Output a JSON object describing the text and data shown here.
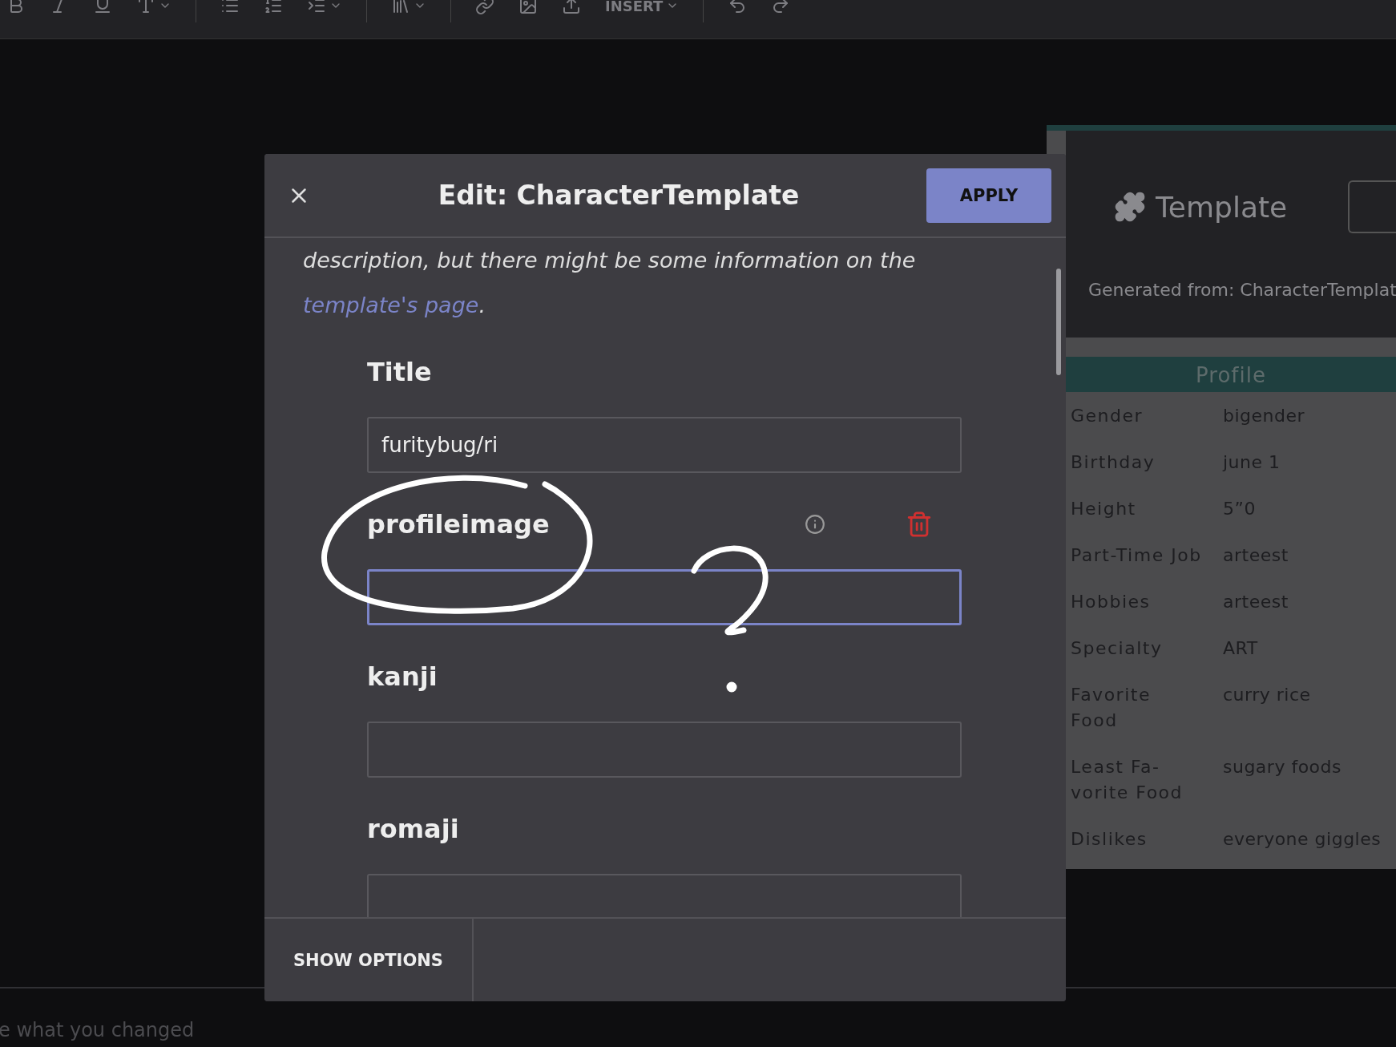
{
  "toolbar": {
    "insert_label": "INSERT"
  },
  "modal": {
    "title": "Edit: CharacterTemplate",
    "apply": "APPLY",
    "description": {
      "text": "description, but there might be some information on the",
      "link": "template's page",
      "end": "."
    },
    "fields": [
      {
        "label": "Title",
        "value": "furitybug/ri",
        "focused": false,
        "removable": false
      },
      {
        "label": "profileimage",
        "focused": true,
        "removable": true
      },
      {
        "label": "kanji",
        "focused": false,
        "removable": false
      },
      {
        "label": "romaji",
        "focused": false,
        "removable": false
      }
    ],
    "footer_button": "SHOW OPTIONS"
  },
  "template_panel": {
    "title": "Template",
    "generated": "Generated from: CharacterTemplat",
    "section": "Profile",
    "rows": [
      {
        "label": "Gender",
        "value": "bigender"
      },
      {
        "label": "Birthday",
        "value": "june 1"
      },
      {
        "label": "Height",
        "value": "5”0"
      },
      {
        "label": "Part-Time Job",
        "value": "arteest"
      },
      {
        "label": "Hobbies",
        "value": "arteest"
      },
      {
        "label": "Specialty",
        "value": "ART"
      },
      {
        "label": "Favorite Food",
        "value": "curry rice"
      },
      {
        "label": "Least Fa-vorite Food",
        "value": "sugary foods"
      },
      {
        "label": "Dislikes",
        "value": "everyone giggles"
      }
    ]
  },
  "edit_summary": {
    "placeholder": "e what you changed"
  }
}
